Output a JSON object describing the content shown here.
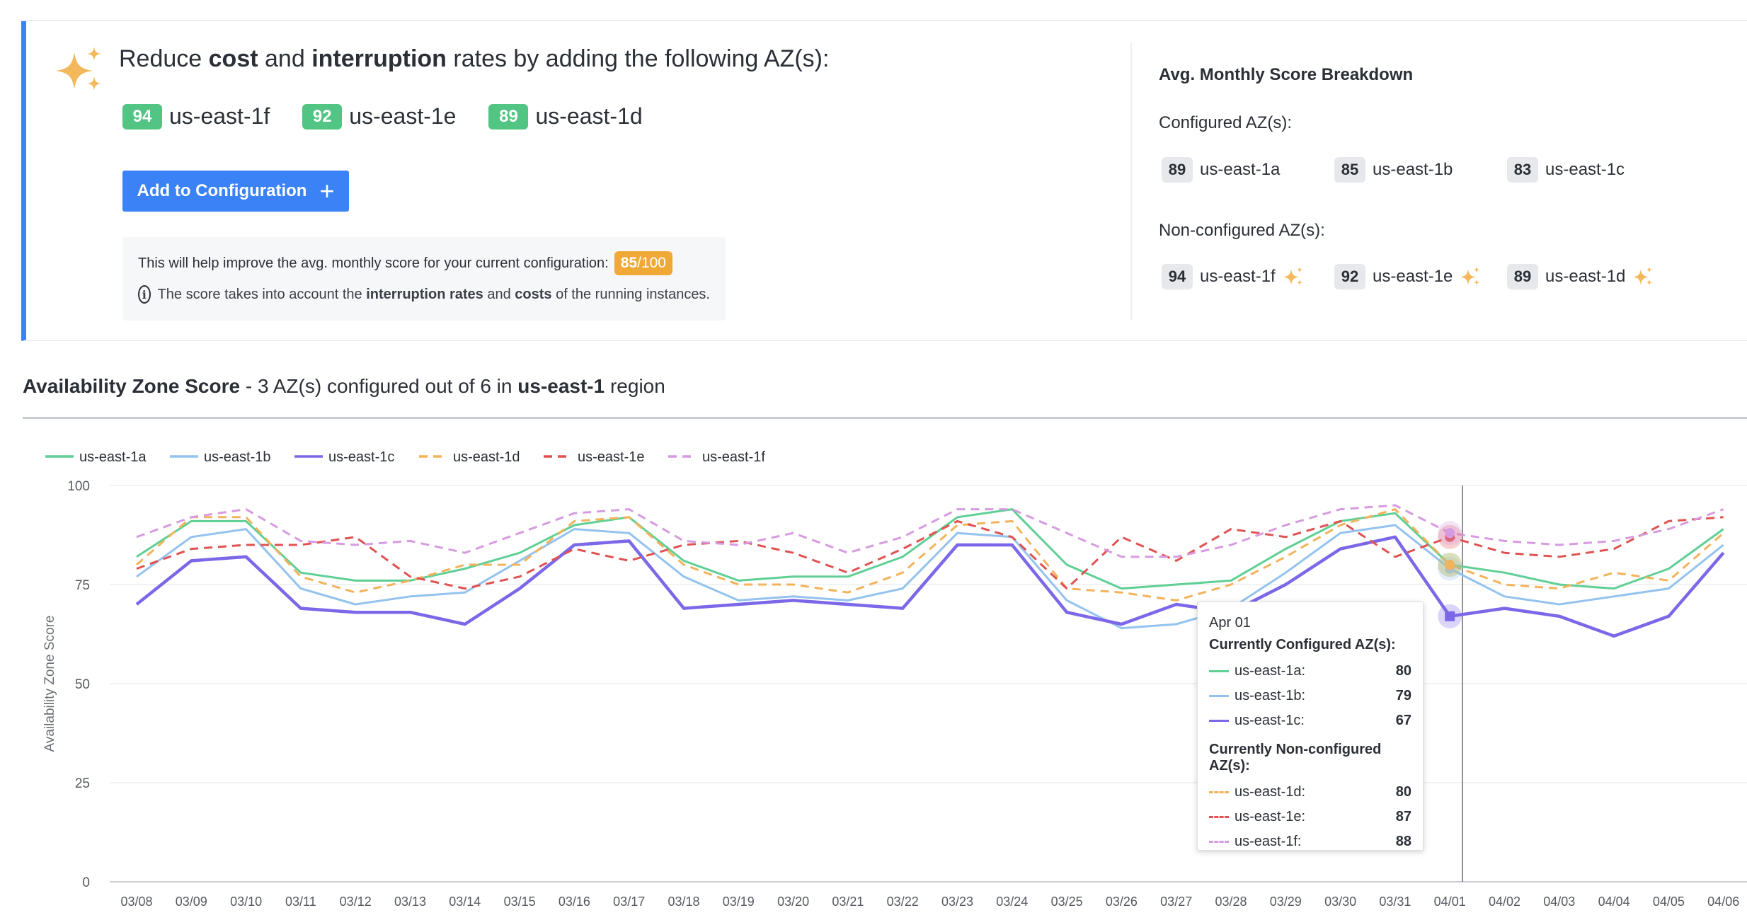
{
  "recommendation": {
    "title_pre": "Reduce ",
    "title_b1": "cost",
    "title_mid": " and ",
    "title_b2": "interruption",
    "title_post": " rates by adding the following AZ(s):",
    "azs": [
      {
        "score": "94",
        "name": "us-east-1f"
      },
      {
        "score": "92",
        "name": "us-east-1e"
      },
      {
        "score": "89",
        "name": "us-east-1d"
      }
    ],
    "add_button_label": "Add to Configuration",
    "info_text": "This will help improve the avg. monthly score for your current configuration:",
    "info_score": "85",
    "info_score_den": "/100",
    "note_pre": "The score takes into account the ",
    "note_b1": "interruption rates",
    "note_mid": " and ",
    "note_b2": "costs",
    "note_post": " of the running instances."
  },
  "breakdown": {
    "title": "Avg. Monthly Score Breakdown",
    "configured_label": "Configured AZ(s):",
    "configured": [
      {
        "score": "89",
        "name": "us-east-1a"
      },
      {
        "score": "85",
        "name": "us-east-1b"
      },
      {
        "score": "83",
        "name": "us-east-1c"
      }
    ],
    "nonconfigured_label": "Non-configured AZ(s):",
    "nonconfigured": [
      {
        "score": "94",
        "name": "us-east-1f"
      },
      {
        "score": "92",
        "name": "us-east-1e"
      },
      {
        "score": "89",
        "name": "us-east-1d"
      }
    ]
  },
  "section": {
    "title_b": "Availability Zone Score",
    "title_mid": " - 3 AZ(s) configured out of 6 in ",
    "title_region": "us-east-1",
    "title_post": " region"
  },
  "tooltip": {
    "date": "Apr 01",
    "configured_head": "Currently Configured AZ(s):",
    "nonconfigured_head": "Currently Non-configured AZ(s):",
    "configured": [
      {
        "name": "us-east-1a:",
        "value": "80"
      },
      {
        "name": "us-east-1b:",
        "value": "79"
      },
      {
        "name": "us-east-1c:",
        "value": "67"
      }
    ],
    "nonconfigured": [
      {
        "name": "us-east-1d:",
        "value": "80"
      },
      {
        "name": "us-east-1e:",
        "value": "87"
      },
      {
        "name": "us-east-1f:",
        "value": "88"
      }
    ]
  },
  "colors": {
    "us-east-1a": "#5fcf95",
    "us-east-1b": "#93c3ee",
    "us-east-1c": "#7b68e8",
    "us-east-1d": "#f2b35a",
    "us-east-1e": "#e05252",
    "us-east-1f": "#d69be0"
  },
  "chart_data": {
    "type": "line",
    "ylabel": "Availability Zone Score",
    "ylim": [
      0,
      100
    ],
    "yticks": [
      "0",
      "25",
      "50",
      "75",
      "100"
    ],
    "x": [
      "03/08",
      "03/09",
      "03/10",
      "03/11",
      "03/12",
      "03/13",
      "03/14",
      "03/15",
      "03/16",
      "03/17",
      "03/18",
      "03/19",
      "03/20",
      "03/21",
      "03/22",
      "03/23",
      "03/24",
      "03/25",
      "03/26",
      "03/27",
      "03/28",
      "03/29",
      "03/30",
      "03/31",
      "04/01",
      "04/02",
      "04/03",
      "04/04",
      "04/05",
      "04/06"
    ],
    "highlight_x": "04/01",
    "legend_position": "top-left",
    "grid": true,
    "series": [
      {
        "name": "us-east-1a",
        "dashed": false,
        "values": [
          82,
          91,
          91,
          78,
          76,
          76,
          79,
          83,
          90,
          92,
          81,
          76,
          77,
          77,
          82,
          92,
          94,
          80,
          74,
          75,
          76,
          84,
          91,
          93,
          80,
          78,
          75,
          74,
          79,
          89
        ]
      },
      {
        "name": "us-east-1b",
        "dashed": false,
        "values": [
          77,
          87,
          89,
          74,
          70,
          72,
          73,
          81,
          89,
          88,
          77,
          71,
          72,
          71,
          74,
          88,
          87,
          71,
          64,
          65,
          69,
          78,
          88,
          90,
          79,
          72,
          70,
          72,
          74,
          85
        ]
      },
      {
        "name": "us-east-1c",
        "dashed": false,
        "values": [
          70,
          81,
          82,
          69,
          68,
          68,
          65,
          74,
          85,
          86,
          69,
          70,
          71,
          70,
          69,
          85,
          85,
          68,
          65,
          70,
          68,
          75,
          84,
          87,
          67,
          69,
          67,
          62,
          67,
          83
        ]
      },
      {
        "name": "us-east-1d",
        "dashed": true,
        "values": [
          80,
          92,
          92,
          77,
          73,
          76,
          80,
          80,
          91,
          92,
          80,
          75,
          75,
          73,
          78,
          90,
          91,
          74,
          73,
          71,
          75,
          82,
          90,
          94,
          80,
          75,
          74,
          78,
          76,
          88
        ]
      },
      {
        "name": "us-east-1e",
        "dashed": true,
        "values": [
          79,
          84,
          85,
          85,
          87,
          77,
          74,
          77,
          84,
          81,
          85,
          86,
          83,
          78,
          84,
          91,
          87,
          74,
          87,
          81,
          89,
          87,
          91,
          82,
          87,
          83,
          82,
          84,
          91,
          92
        ]
      },
      {
        "name": "us-east-1f",
        "dashed": true,
        "values": [
          87,
          92,
          94,
          86,
          85,
          86,
          83,
          88,
          93,
          94,
          86,
          85,
          88,
          83,
          87,
          94,
          94,
          88,
          82,
          82,
          85,
          90,
          94,
          95,
          88,
          86,
          85,
          86,
          89,
          94
        ]
      }
    ]
  }
}
